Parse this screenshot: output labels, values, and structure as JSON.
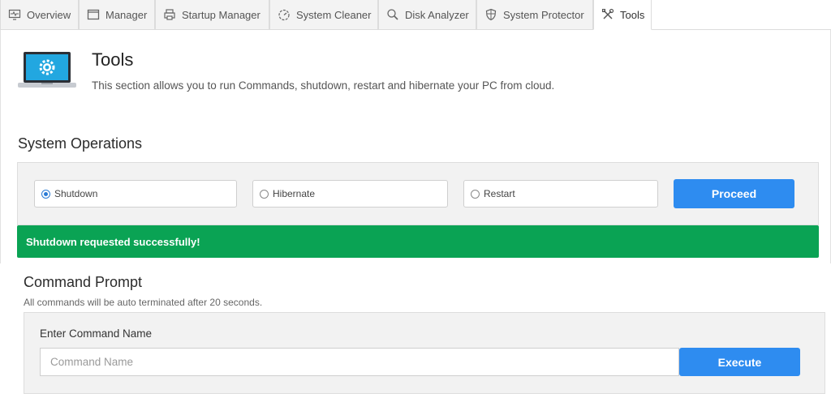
{
  "tabs": [
    {
      "label": "Overview",
      "icon": "monitor-heart-icon"
    },
    {
      "label": "Manager",
      "icon": "window-icon"
    },
    {
      "label": "Startup Manager",
      "icon": "printer-icon"
    },
    {
      "label": "System Cleaner",
      "icon": "gauge-icon"
    },
    {
      "label": "Disk Analyzer",
      "icon": "magnifier-icon"
    },
    {
      "label": "System Protector",
      "icon": "shield-icon"
    },
    {
      "label": "Tools",
      "icon": "tools-icon",
      "active": true
    }
  ],
  "header": {
    "title": "Tools",
    "description": "This section allows you to run Commands, shutdown, restart and hibernate your PC from cloud."
  },
  "system_operations": {
    "heading": "System Operations",
    "options": [
      {
        "label": "Shutdown",
        "selected": true
      },
      {
        "label": "Hibernate",
        "selected": false
      },
      {
        "label": "Restart",
        "selected": false
      }
    ],
    "proceed_label": "Proceed"
  },
  "alert": {
    "message": "Shutdown requested successfully!",
    "color": "#0aa354"
  },
  "command_prompt": {
    "heading": "Command Prompt",
    "note": "All commands will be auto terminated after 20 seconds.",
    "field_label": "Enter Command Name",
    "placeholder": "Command Name",
    "value": "",
    "execute_label": "Execute"
  },
  "colors": {
    "accent": "#2e8cf0",
    "success": "#0aa354"
  }
}
